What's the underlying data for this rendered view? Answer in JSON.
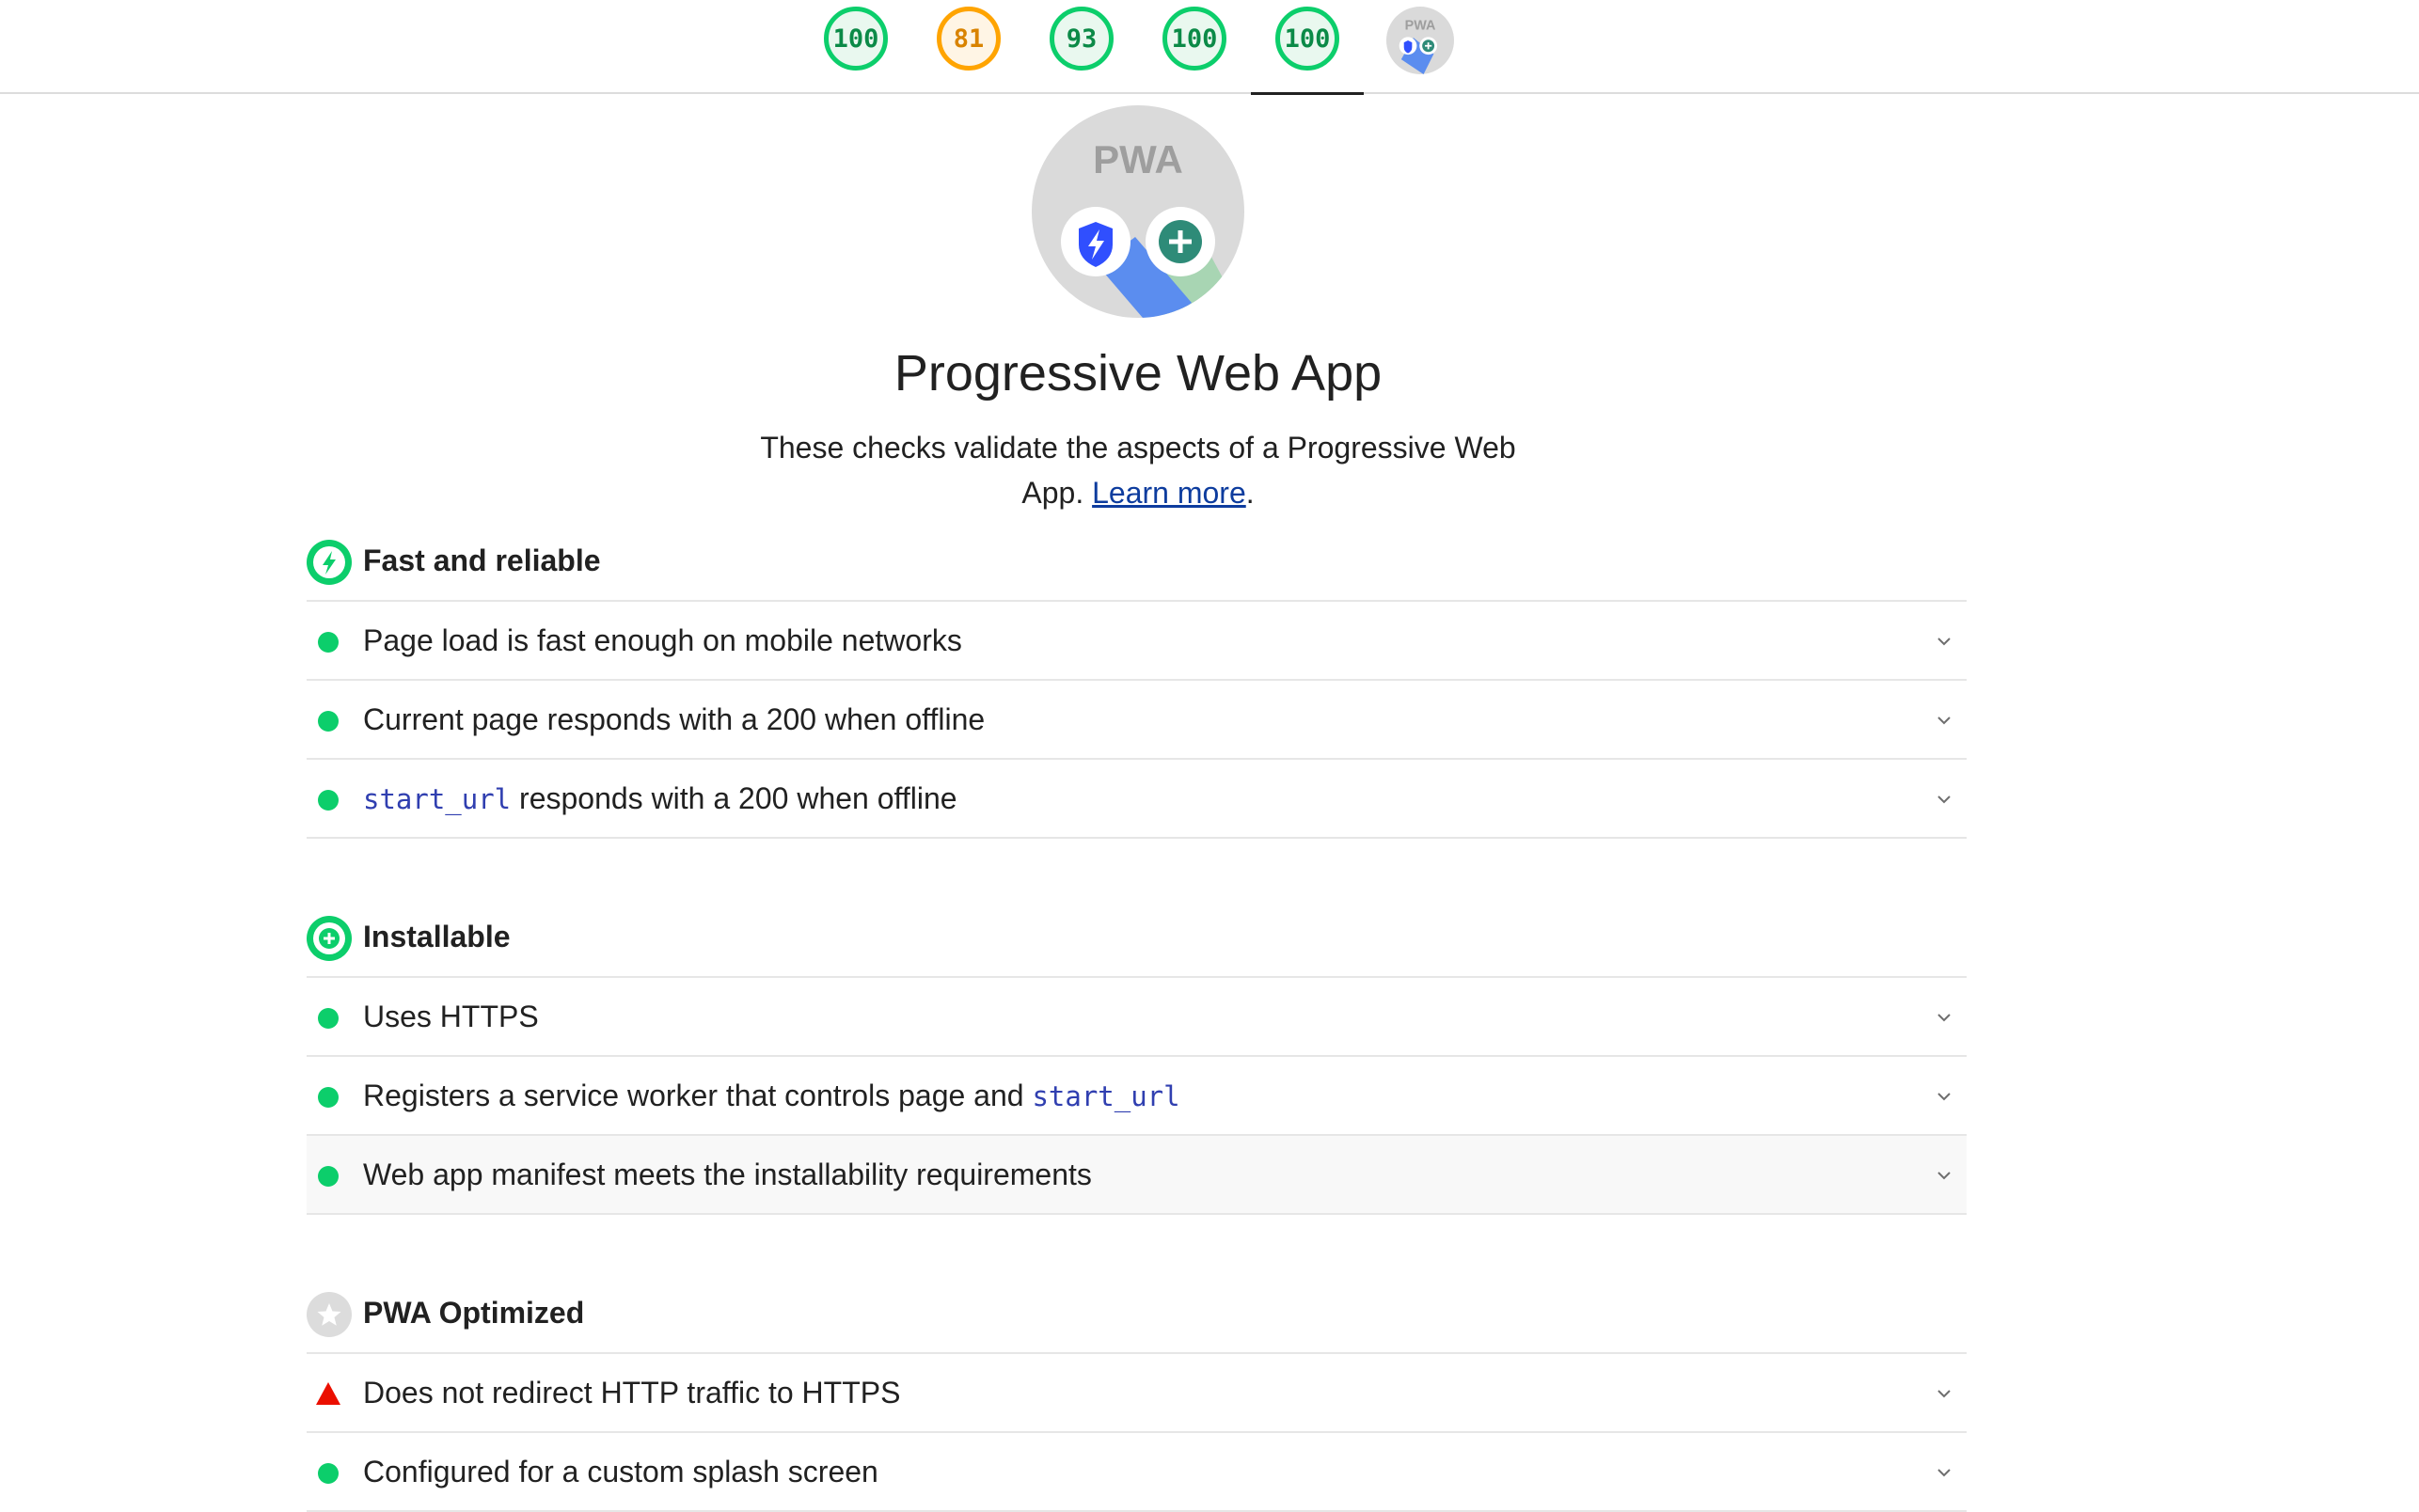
{
  "scores": [
    {
      "label": "100",
      "rating": "pass"
    },
    {
      "label": "81",
      "rating": "average"
    },
    {
      "label": "93",
      "rating": "pass"
    },
    {
      "label": "100",
      "rating": "pass"
    },
    {
      "label": "100",
      "rating": "pass",
      "active": true
    },
    {
      "label": "PWA",
      "icon": "pwa-badge-icon"
    }
  ],
  "category": {
    "logo_text": "PWA",
    "title": "Progressive Web App",
    "description": "These checks validate the aspects of a Progressive Web App.",
    "link_text": "Learn more",
    "link_suffix": "."
  },
  "groups": [
    {
      "title": "Fast and reliable",
      "icon": "lightning-badge-icon",
      "audits": [
        {
          "pre": "Page load is fast enough on mobile networks",
          "status": "pass"
        },
        {
          "pre": "Current page responds with a 200 when offline",
          "status": "pass"
        },
        {
          "code": "start_url",
          "post": " responds with a 200 when offline",
          "status": "pass"
        }
      ]
    },
    {
      "title": "Installable",
      "icon": "plus-badge-icon",
      "audits": [
        {
          "pre": "Uses HTTPS",
          "status": "pass"
        },
        {
          "pre": "Registers a service worker that controls page and ",
          "code": "start_url",
          "status": "pass"
        },
        {
          "pre": "Web app manifest meets the installability requirements",
          "status": "pass"
        }
      ]
    },
    {
      "title": "PWA Optimized",
      "icon": "star-badge-icon",
      "audits": [
        {
          "pre": "Does not redirect HTTP traffic to HTTPS",
          "status": "fail"
        },
        {
          "pre": "Configured for a custom splash screen",
          "status": "pass"
        }
      ]
    }
  ],
  "colors": {
    "pass": "#0cce6b",
    "average": "#ffa400",
    "fail": "#eb0f00",
    "link": "#0d3c9e",
    "code": "#303fb0"
  }
}
